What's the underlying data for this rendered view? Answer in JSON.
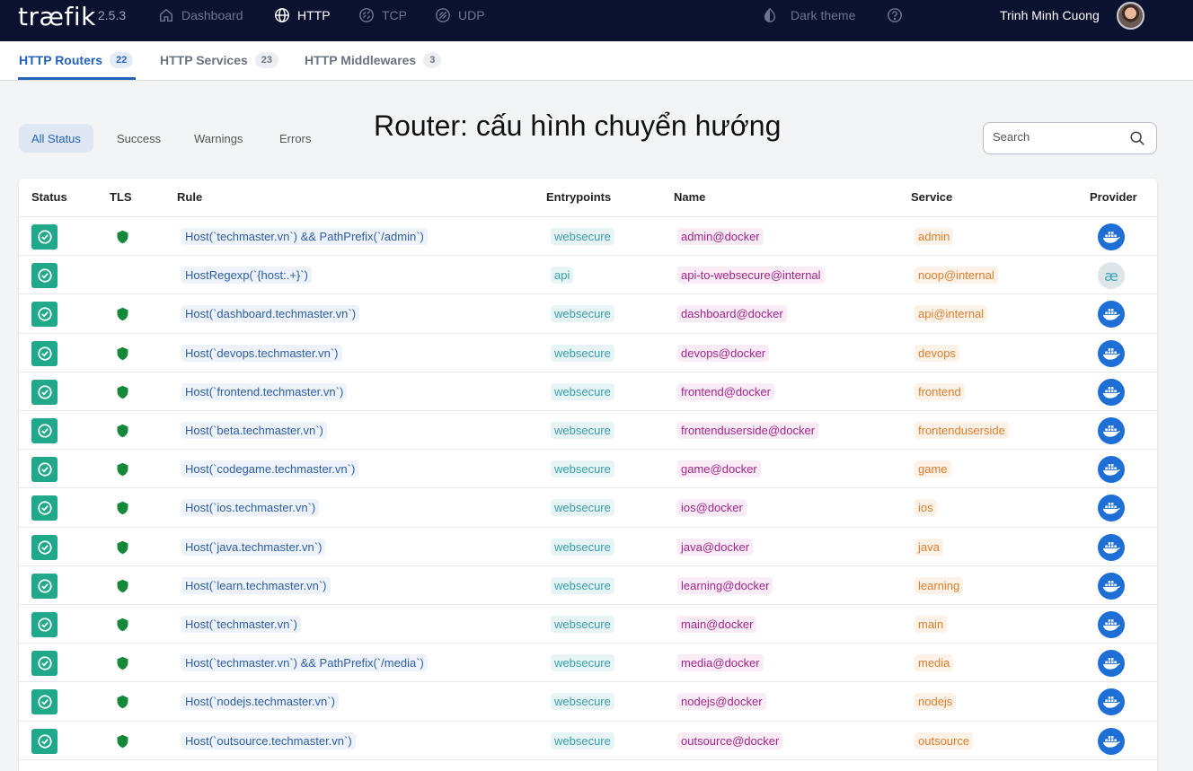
{
  "app": {
    "logo": "træfik",
    "version": "2.5.3",
    "nav": [
      {
        "label": "Dashboard",
        "icon": "home-icon",
        "active": false
      },
      {
        "label": "HTTP",
        "icon": "globe-icon",
        "active": true
      },
      {
        "label": "TCP",
        "icon": "tcp-icon",
        "active": false
      },
      {
        "label": "UDP",
        "icon": "udp-icon",
        "active": false
      }
    ],
    "theme_label": "Dark theme",
    "help_icon": "help-icon",
    "user_name": "Trinh Minh Cuong"
  },
  "subtabs": [
    {
      "label": "HTTP Routers",
      "count": "22",
      "active": true
    },
    {
      "label": "HTTP Services",
      "count": "23",
      "active": false
    },
    {
      "label": "HTTP Middlewares",
      "count": "3",
      "active": false
    }
  ],
  "filters": [
    {
      "label": "All Status",
      "active": true
    },
    {
      "label": "Success",
      "active": false
    },
    {
      "label": "Warnings",
      "active": false
    },
    {
      "label": "Errors",
      "active": false
    }
  ],
  "page_title": "Router: cấu hình chuyển hướng",
  "search": {
    "placeholder": "Search",
    "value": ""
  },
  "columns": [
    "Status",
    "TLS",
    "Rule",
    "Entrypoints",
    "Name",
    "Service",
    "Provider"
  ],
  "colors": {
    "success": "#1fa98a",
    "tls": "#16883a",
    "accent": "#2563b8",
    "docker": "#1d6fd6",
    "navbar": "#0b1230"
  },
  "rows": [
    {
      "status": "success",
      "tls": true,
      "rule": "Host(`techmaster.vn`) && PathPrefix(`/admin`)",
      "entrypoint": "websecure",
      "name": "admin@docker",
      "service": "admin",
      "provider": "docker"
    },
    {
      "status": "success",
      "tls": false,
      "rule": "HostRegexp(`{host:.+}`)",
      "entrypoint": "api",
      "name": "api-to-websecure@internal",
      "service": "noop@internal",
      "provider": "internal"
    },
    {
      "status": "success",
      "tls": true,
      "rule": "Host(`dashboard.techmaster.vn`)",
      "entrypoint": "websecure",
      "name": "dashboard@docker",
      "service": "api@internal",
      "provider": "docker"
    },
    {
      "status": "success",
      "tls": true,
      "rule": "Host(`devops.techmaster.vn`)",
      "entrypoint": "websecure",
      "name": "devops@docker",
      "service": "devops",
      "provider": "docker"
    },
    {
      "status": "success",
      "tls": true,
      "rule": "Host(`frontend.techmaster.vn`)",
      "entrypoint": "websecure",
      "name": "frontend@docker",
      "service": "frontend",
      "provider": "docker"
    },
    {
      "status": "success",
      "tls": true,
      "rule": "Host(`beta.techmaster.vn`)",
      "entrypoint": "websecure",
      "name": "frontenduserside@docker",
      "service": "frontenduserside",
      "provider": "docker"
    },
    {
      "status": "success",
      "tls": true,
      "rule": "Host(`codegame.techmaster.vn`)",
      "entrypoint": "websecure",
      "name": "game@docker",
      "service": "game",
      "provider": "docker"
    },
    {
      "status": "success",
      "tls": true,
      "rule": "Host(`ios.techmaster.vn`)",
      "entrypoint": "websecure",
      "name": "ios@docker",
      "service": "ios",
      "provider": "docker"
    },
    {
      "status": "success",
      "tls": true,
      "rule": "Host(`java.techmaster.vn`)",
      "entrypoint": "websecure",
      "name": "java@docker",
      "service": "java",
      "provider": "docker"
    },
    {
      "status": "success",
      "tls": true,
      "rule": "Host(`learn.techmaster.vn`)",
      "entrypoint": "websecure",
      "name": "learning@docker",
      "service": "learning",
      "provider": "docker"
    },
    {
      "status": "success",
      "tls": true,
      "rule": "Host(`techmaster.vn`)",
      "entrypoint": "websecure",
      "name": "main@docker",
      "service": "main",
      "provider": "docker"
    },
    {
      "status": "success",
      "tls": true,
      "rule": "Host(`techmaster.vn`) && PathPrefix(`/media`)",
      "entrypoint": "websecure",
      "name": "media@docker",
      "service": "media",
      "provider": "docker"
    },
    {
      "status": "success",
      "tls": true,
      "rule": "Host(`nodejs.techmaster.vn`)",
      "entrypoint": "websecure",
      "name": "nodejs@docker",
      "service": "nodejs",
      "provider": "docker"
    },
    {
      "status": "success",
      "tls": true,
      "rule": "Host(`outsource.techmaster.vn`)",
      "entrypoint": "websecure",
      "name": "outsource@docker",
      "service": "outsource",
      "provider": "docker"
    }
  ]
}
